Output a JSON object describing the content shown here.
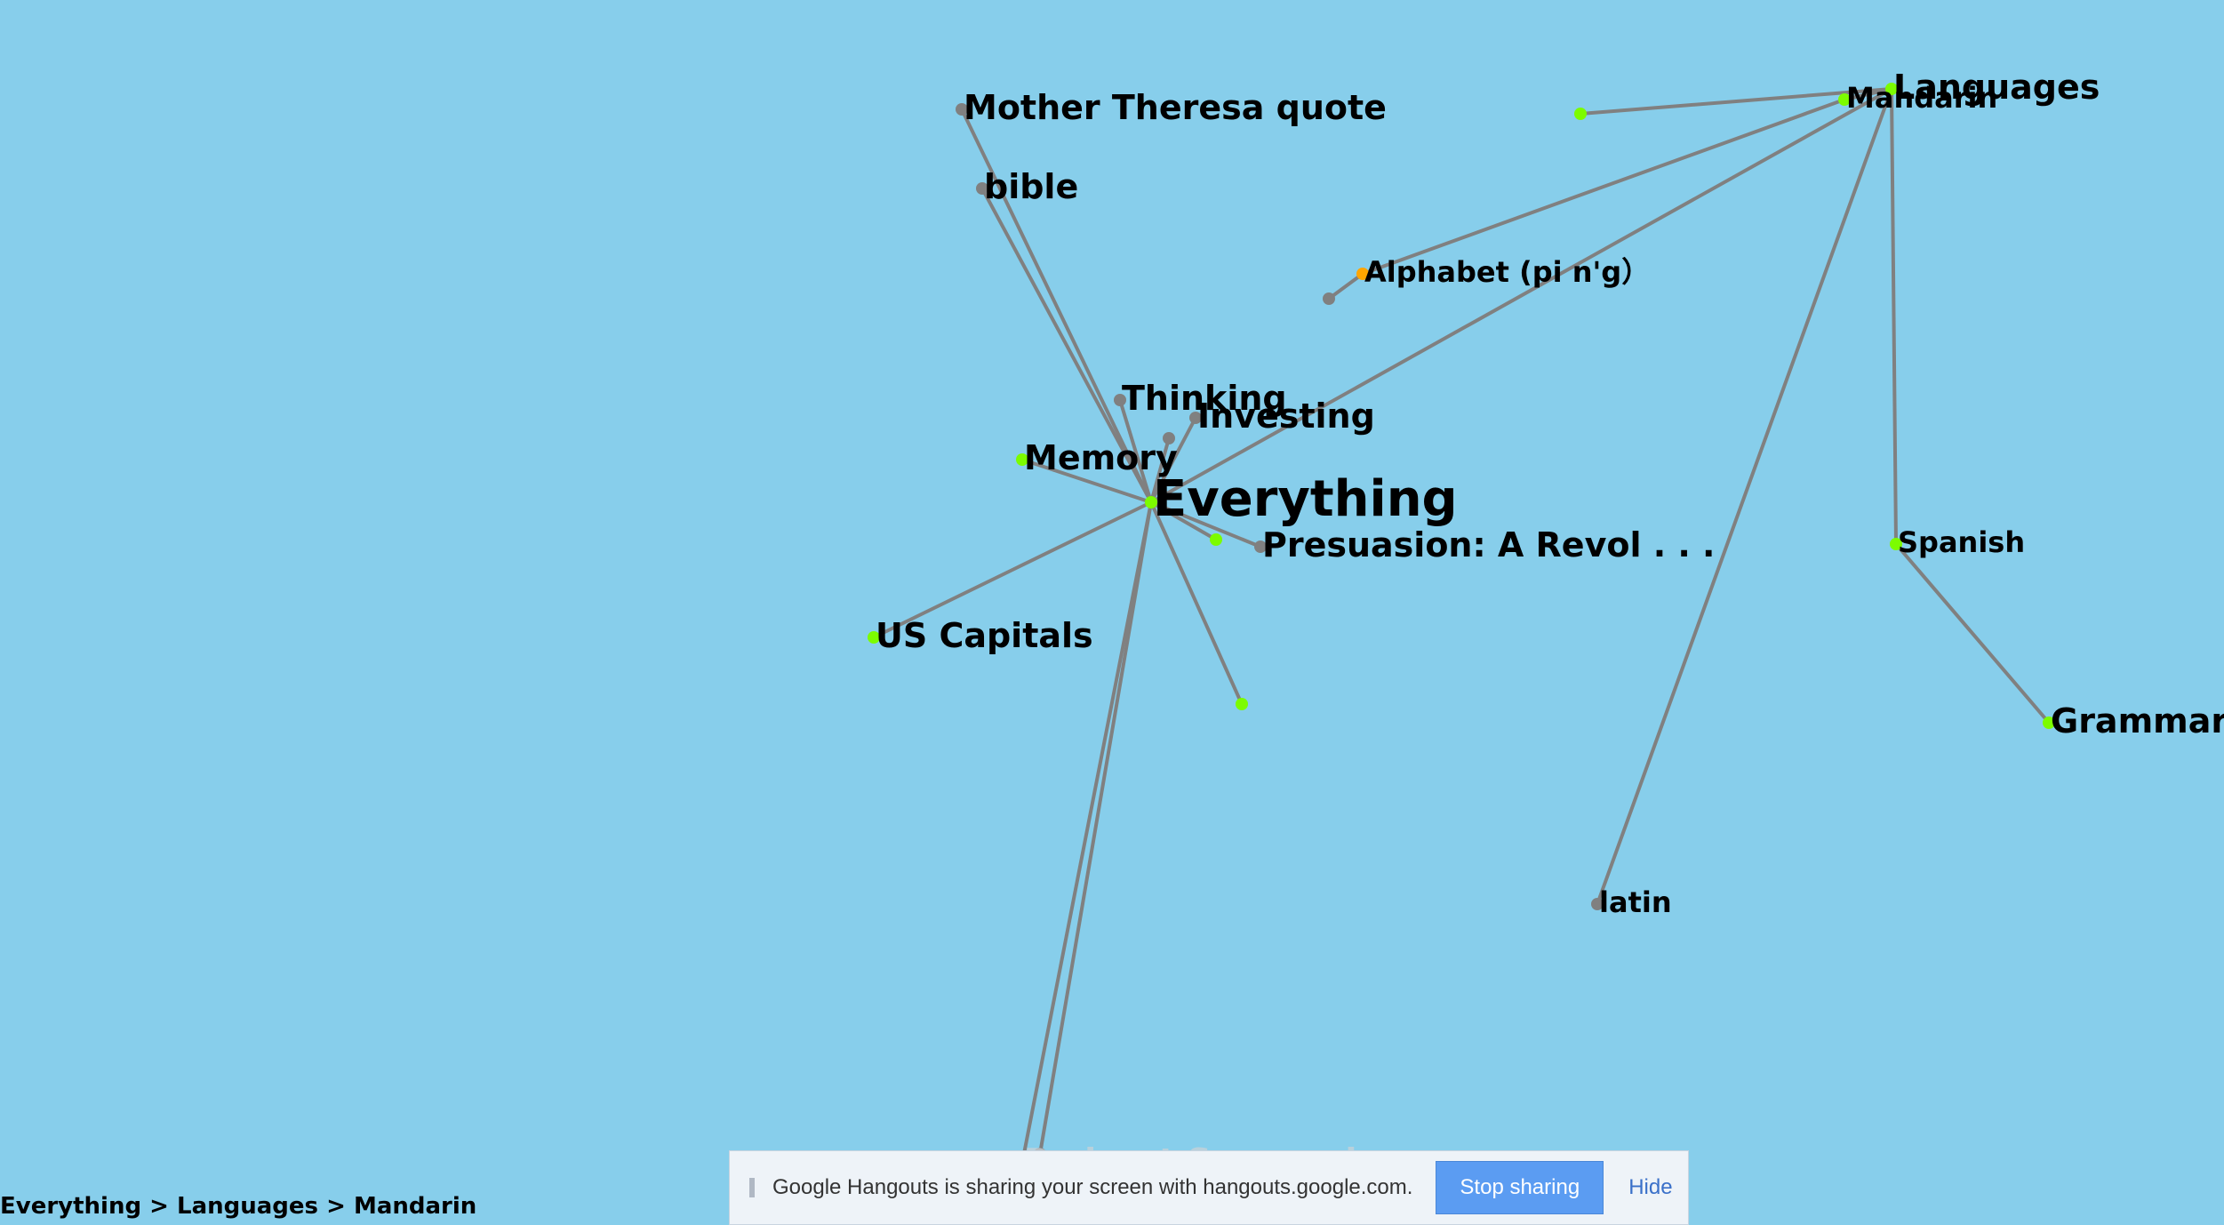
{
  "graph": {
    "nodes": [
      {
        "id": "everything",
        "label": "Everything",
        "size": "xl",
        "dot": "#7CFC00"
      },
      {
        "id": "mother",
        "label": "Mother Theresa quote",
        "size": "l",
        "dot": "#808080"
      },
      {
        "id": "bible",
        "label": "bible",
        "size": "l",
        "dot": "#808080"
      },
      {
        "id": "thinking",
        "label": "Thinking",
        "size": "l",
        "dot": "#808080"
      },
      {
        "id": "investing",
        "label": "Investing",
        "size": "l",
        "dot": "#808080"
      },
      {
        "id": "memory",
        "label": "Memory",
        "size": "l",
        "dot": "#7CFC00"
      },
      {
        "id": "presuasion",
        "label": "Presuasion: A Revol . . .",
        "size": "l",
        "dot": "#808080"
      },
      {
        "id": "uscapitals",
        "label": "US Capitals",
        "size": "l",
        "dot": "#7CFC00"
      },
      {
        "id": "podcast",
        "label": "Podcast Summaries",
        "size": "l",
        "dot": "#808080",
        "faded": true
      },
      {
        "id": "languages",
        "label": "Languages",
        "size": "l",
        "dot": "#7CFC00"
      },
      {
        "id": "mandarin",
        "label": "Mandarin",
        "size": "m",
        "dot": "#7CFC00"
      },
      {
        "id": "alphabet",
        "label": "Alphabet (pi n'g）",
        "size": "m",
        "dot": "#FFA500"
      },
      {
        "id": "spanish",
        "label": "Spanish",
        "size": "m",
        "dot": "#7CFC00"
      },
      {
        "id": "grammar",
        "label": "Grammar",
        "size": "l",
        "dot": "#7CFC00"
      },
      {
        "id": "latin",
        "label": "latin",
        "size": "m",
        "dot": "#808080"
      },
      {
        "id": "dot1",
        "label": "",
        "size": "s",
        "dot": "#808080"
      },
      {
        "id": "dot2",
        "label": "",
        "size": "s",
        "dot": "#7CFC00"
      },
      {
        "id": "dot3",
        "label": "",
        "size": "s",
        "dot": "#7CFC00"
      },
      {
        "id": "dot4",
        "label": "",
        "size": "s",
        "dot": "#808080"
      },
      {
        "id": "dot5",
        "label": "",
        "size": "s",
        "dot": "#7CFC00"
      },
      {
        "id": "dot6",
        "label": "",
        "size": "s",
        "dot": "#808080"
      }
    ],
    "edges": [
      [
        "everything",
        "mother"
      ],
      [
        "everything",
        "bible"
      ],
      [
        "everything",
        "thinking"
      ],
      [
        "everything",
        "investing"
      ],
      [
        "everything",
        "memory"
      ],
      [
        "everything",
        "presuasion"
      ],
      [
        "everything",
        "uscapitals"
      ],
      [
        "everything",
        "podcast"
      ],
      [
        "everything",
        "languages"
      ],
      [
        "everything",
        "dot1"
      ],
      [
        "everything",
        "dot2"
      ],
      [
        "everything",
        "dot3"
      ],
      [
        "everything",
        "dot6"
      ],
      [
        "languages",
        "mandarin"
      ],
      [
        "languages",
        "spanish"
      ],
      [
        "languages",
        "latin"
      ],
      [
        "languages",
        "dot5"
      ],
      [
        "mandarin",
        "alphabet"
      ],
      [
        "alphabet",
        "dot4"
      ],
      [
        "spanish",
        "grammar"
      ]
    ]
  },
  "breadcrumb": {
    "items": [
      "Everything",
      "Languages",
      "Mandarin"
    ],
    "separator": ">"
  },
  "share_bar": {
    "message": "Google Hangouts is sharing your screen with hangouts.google.com.",
    "stop_label": "Stop sharing",
    "hide_label": "Hide"
  }
}
